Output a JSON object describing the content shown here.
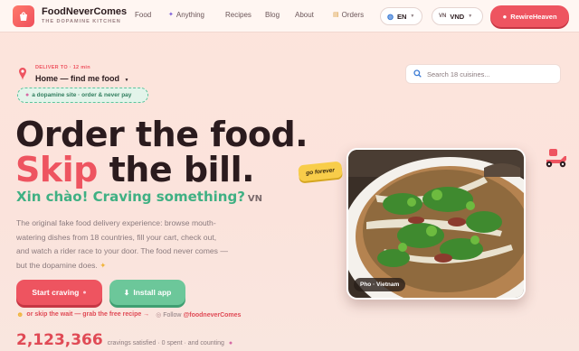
{
  "brand": {
    "name": "FoodNeverComes",
    "tagline": "THE DOPAMINE KITCHEN"
  },
  "nav": {
    "links": [
      "Food",
      "Anything",
      "Recipes",
      "Blog",
      "About",
      "Orders"
    ],
    "language": "EN",
    "currency_prefix": "VN",
    "currency": "VND",
    "cta": "RewireHeaven"
  },
  "deliver": {
    "label": "DELIVER TO · 12 min",
    "address": "Home — find me food"
  },
  "site_chip": "a dopamine site · order & never pay",
  "headline": {
    "line1": "Order the food.",
    "line2_red": "Skip",
    "line2_rest": " the bill."
  },
  "greeting": {
    "text": "Xin chào! Craving something?",
    "lang": "VN"
  },
  "description": "The original fake food delivery experience: browse mouth-watering dishes from 18 countries, fill your cart, check out, and watch a rider race to your door. The food never comes — but the dopamine does.",
  "buttons": {
    "start": "Start craving",
    "install": "Install app"
  },
  "skip": {
    "text": "or skip the wait — grab the free recipe →",
    "follow_label": "Follow",
    "handle": "@foodneverComes"
  },
  "counter": {
    "number": "2,123,366",
    "text": "cravings satisfied · 0 spent · and counting"
  },
  "search": {
    "placeholder": "Search 18 cuisines..."
  },
  "photo": {
    "tag": "Pho · Vietnam",
    "sticker": "go forever"
  },
  "colors": {
    "accent": "#ee5460",
    "green": "#3fb083",
    "yellow": "#f8cd4a"
  }
}
